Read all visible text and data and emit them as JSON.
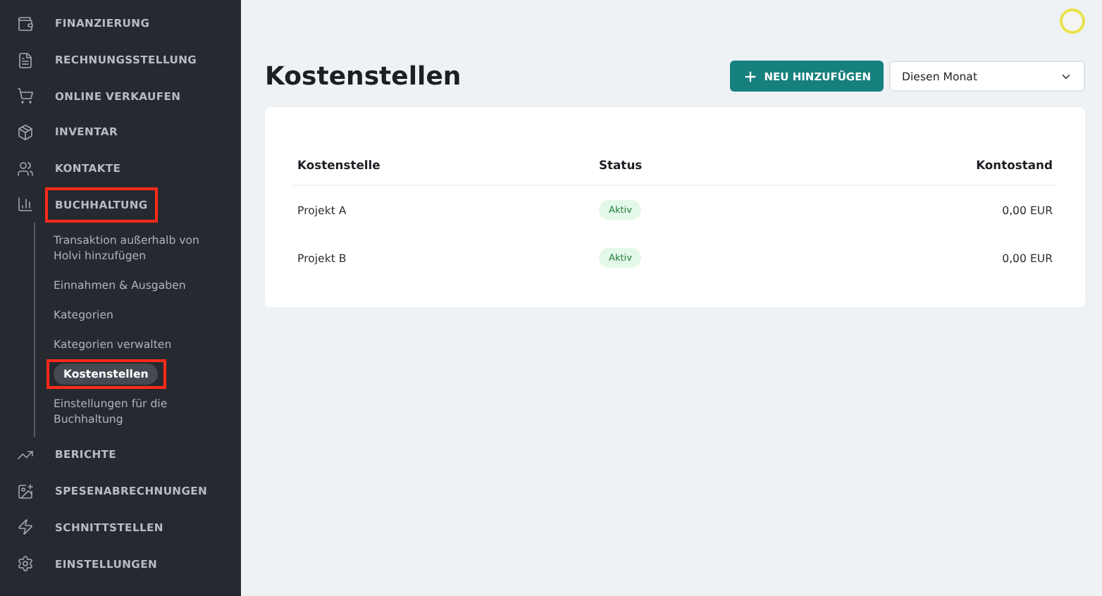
{
  "sidebar": {
    "items": [
      {
        "label": "FINANZIERUNG",
        "highlighted": false
      },
      {
        "label": "RECHNUNGSSTELLUNG",
        "highlighted": false
      },
      {
        "label": "ONLINE VERKAUFEN",
        "highlighted": false
      },
      {
        "label": "INVENTAR",
        "highlighted": false
      },
      {
        "label": "KONTAKTE",
        "highlighted": false
      },
      {
        "label": "BUCHHALTUNG",
        "highlighted": true,
        "expanded": true,
        "children": [
          {
            "label": "Transaktion außerhalb von Holvi hinzufügen",
            "selected": false,
            "highlighted": false
          },
          {
            "label": "Einnahmen & Ausgaben",
            "selected": false,
            "highlighted": false
          },
          {
            "label": "Kategorien",
            "selected": false,
            "highlighted": false
          },
          {
            "label": "Kategorien verwalten",
            "selected": false,
            "highlighted": false
          },
          {
            "label": "Kostenstellen",
            "selected": true,
            "highlighted": true
          },
          {
            "label": "Einstellungen für die Buchhaltung",
            "selected": false,
            "highlighted": false
          }
        ]
      },
      {
        "label": "BERICHTE",
        "highlighted": false
      },
      {
        "label": "SPESENABRECHNUNGEN",
        "highlighted": false
      },
      {
        "label": "SCHNITTSTELLEN",
        "highlighted": false
      },
      {
        "label": "EINSTELLUNGEN",
        "highlighted": false
      }
    ]
  },
  "page": {
    "title": "Kostenstellen",
    "add_button": "NEU HINZUFÜGEN",
    "period_select": "Diesen Monat"
  },
  "table": {
    "columns": [
      "Kostenstelle",
      "Status",
      "Kontostand"
    ],
    "rows": [
      {
        "name": "Projekt A",
        "status": "Aktiv",
        "balance": "0,00 EUR"
      },
      {
        "name": "Projekt B",
        "status": "Aktiv",
        "balance": "0,00 EUR"
      }
    ]
  }
}
